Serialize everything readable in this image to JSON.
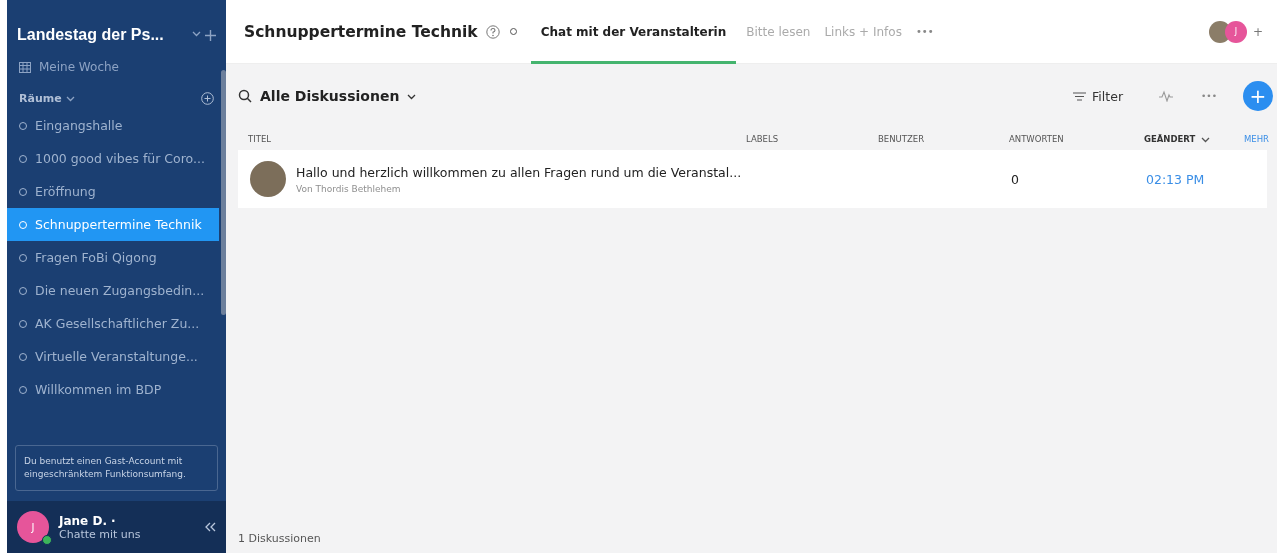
{
  "sidebar": {
    "workspace_title": "Landestag der Ps...",
    "my_week": "Meine Woche",
    "rooms_label": "Räume",
    "rooms": [
      {
        "label": "Eingangshalle",
        "selected": false
      },
      {
        "label": "1000 good vibes für Coro...",
        "selected": false
      },
      {
        "label": "Eröffnung",
        "selected": false
      },
      {
        "label": "Schnuppertermine Technik",
        "selected": true
      },
      {
        "label": "Fragen FoBi Qigong",
        "selected": false
      },
      {
        "label": "Die neuen Zugangsbedin...",
        "selected": false
      },
      {
        "label": "AK Gesellschaftlicher Zu...",
        "selected": false
      },
      {
        "label": "Virtuelle Veranstaltunge...",
        "selected": false
      },
      {
        "label": "Willkommen im BDP",
        "selected": false
      }
    ],
    "guest_notice": "Du benutzt einen Gast-Account mit eingeschränktem Funktionsumfang.",
    "user": {
      "initial": "J",
      "name": "Jane D.",
      "status_mark": "·",
      "subtitle": "Chatte mit uns",
      "online": true
    }
  },
  "header": {
    "title": "Schnuppertermine Technik",
    "tabs": [
      {
        "label": "Chat mit der Veranstalterin",
        "selected": true
      },
      {
        "label": "Bitte lesen",
        "selected": false
      },
      {
        "label": "Links + Infos",
        "selected": false
      }
    ],
    "more": "•••",
    "member_initial": "J",
    "add_member": "+"
  },
  "toolbar": {
    "view": "Alle Diskussionen",
    "filter": "Filter",
    "more": "•••",
    "add": "+"
  },
  "table": {
    "columns": [
      {
        "label": "TITEL",
        "sorted": false
      },
      {
        "label": "LABELS",
        "sorted": false
      },
      {
        "label": "BENUTZER",
        "sorted": false
      },
      {
        "label": "ANTWORTEN",
        "sorted": false
      },
      {
        "label": "GEÄNDERT",
        "sorted": true
      }
    ],
    "more_link": "MEHR",
    "rows": [
      {
        "title": "Hallo und herzlich willkommen zu allen Fragen rund um die Veranstal...",
        "author": "Von Thordis Bethlehem",
        "replies": "0",
        "changed": "02:13 PM"
      }
    ]
  },
  "footer": {
    "count": "1 Diskussionen"
  }
}
